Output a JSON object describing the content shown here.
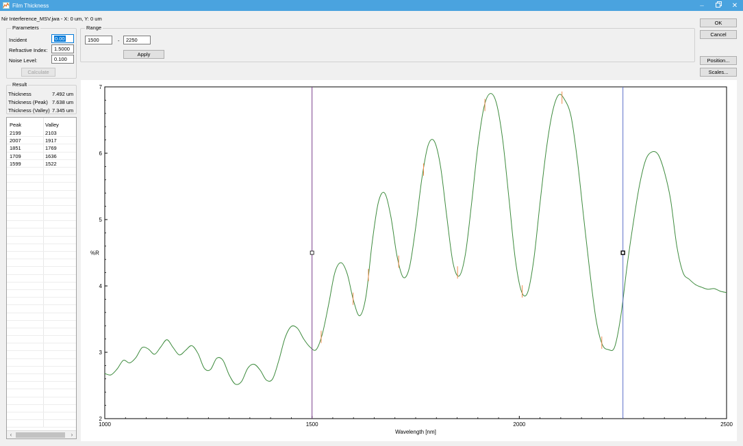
{
  "window": {
    "title": "Film Thickness",
    "buttons": {
      "restore": "🗗",
      "close": "✕"
    }
  },
  "status_line": "Nir Interference_MSV.jwa - X: 0 um, Y: 0 um",
  "parameters": {
    "group_label": "Parameters",
    "incident_label": "Incident",
    "incident_value": "0.00",
    "refractive_label": "Refractive Index:",
    "refractive_value": "1.5000",
    "noise_label": "Noise Level:",
    "noise_value": "0.100",
    "calculate_label": "Calculate"
  },
  "range": {
    "group_label": "Range",
    "from": "1500",
    "separator": "-",
    "to": "2250",
    "apply_label": "Apply"
  },
  "actions": {
    "ok": "OK",
    "cancel": "Cancel",
    "position": "Position...",
    "scales": "Scales..."
  },
  "result": {
    "group_label": "Result",
    "rows": [
      {
        "label": "Thickness",
        "value": "7.492 um"
      },
      {
        "label": "Thickness (Peak)",
        "value": "7.638 um"
      },
      {
        "label": "Thickness (Valley)",
        "value": "7.345 um"
      }
    ]
  },
  "peak_valley_table": {
    "headers": [
      "Peak",
      "Valley"
    ],
    "rows": [
      [
        "2199",
        "2103"
      ],
      [
        "2007",
        "1917"
      ],
      [
        "1851",
        "1769"
      ],
      [
        "1709",
        "1636"
      ],
      [
        "1599",
        "1522"
      ]
    ],
    "empty_rows": 36
  },
  "chart_data": {
    "type": "line",
    "xlabel": "Wavelength [nm]",
    "ylabel": "%R",
    "xlim": [
      1000,
      2500
    ],
    "ylim": [
      2,
      7
    ],
    "x_ticks": [
      1000,
      1500,
      2000,
      2500
    ],
    "y_ticks": [
      2,
      3,
      4,
      5,
      6,
      7
    ],
    "grid": false,
    "line_color": "#3c8a3c",
    "marker_color": "#f08a4b",
    "range_line_colors": [
      "#7a3d8a",
      "#5a6ec8"
    ],
    "range_lines": [
      1500,
      2250
    ],
    "range_marker_y": 4.5,
    "series": [
      {
        "x": [
          1000,
          1015,
          1030,
          1045,
          1060,
          1075,
          1090,
          1105,
          1120,
          1135,
          1150,
          1165,
          1180,
          1195,
          1210,
          1225,
          1240,
          1255,
          1270,
          1285,
          1300,
          1315,
          1330,
          1345,
          1360,
          1375,
          1390,
          1405,
          1420,
          1435,
          1450,
          1465,
          1480,
          1495,
          1510,
          1525,
          1540,
          1555,
          1570,
          1585,
          1600,
          1615,
          1630,
          1645,
          1660,
          1675,
          1690,
          1705,
          1720,
          1735,
          1750,
          1765,
          1780,
          1795,
          1810,
          1825,
          1840,
          1855,
          1870,
          1885,
          1900,
          1915,
          1930,
          1945,
          1960,
          1975,
          1990,
          2005,
          2020,
          2035,
          2050,
          2065,
          2080,
          2095,
          2110,
          2125,
          2140,
          2155,
          2170,
          2185,
          2200,
          2215,
          2230,
          2245,
          2260,
          2275,
          2290,
          2305,
          2320,
          2335,
          2350,
          2365,
          2380,
          2395,
          2410,
          2425,
          2440,
          2455,
          2470,
          2485,
          2500
        ],
        "y": [
          2.68,
          2.66,
          2.75,
          2.88,
          2.84,
          2.92,
          3.07,
          3.05,
          2.97,
          3.08,
          3.19,
          3.07,
          2.96,
          3.03,
          3.1,
          2.98,
          2.76,
          2.74,
          2.91,
          2.88,
          2.66,
          2.52,
          2.56,
          2.76,
          2.82,
          2.73,
          2.58,
          2.6,
          2.88,
          3.22,
          3.39,
          3.36,
          3.2,
          3.08,
          3.04,
          3.28,
          3.72,
          4.2,
          4.35,
          4.18,
          3.78,
          3.55,
          3.84,
          4.65,
          5.26,
          5.4,
          5.05,
          4.45,
          4.13,
          4.28,
          4.88,
          5.62,
          6.12,
          6.18,
          5.8,
          5.05,
          4.35,
          4.15,
          4.48,
          5.25,
          6.1,
          6.7,
          6.9,
          6.75,
          6.2,
          5.32,
          4.42,
          3.92,
          3.9,
          4.4,
          5.25,
          6.05,
          6.62,
          6.88,
          6.8,
          6.55,
          5.9,
          5.05,
          4.22,
          3.5,
          3.12,
          3.04,
          3.08,
          3.55,
          4.3,
          4.95,
          5.52,
          5.9,
          6.02,
          5.98,
          5.72,
          5.3,
          4.6,
          4.2,
          4.1,
          4.02,
          3.98,
          3.95,
          3.96,
          3.92,
          3.9
        ]
      }
    ],
    "peak_markers": [
      1599,
      1709,
      1851,
      2007,
      2199
    ],
    "valley_markers": [
      1522,
      1636,
      1769,
      1917,
      2103
    ]
  }
}
